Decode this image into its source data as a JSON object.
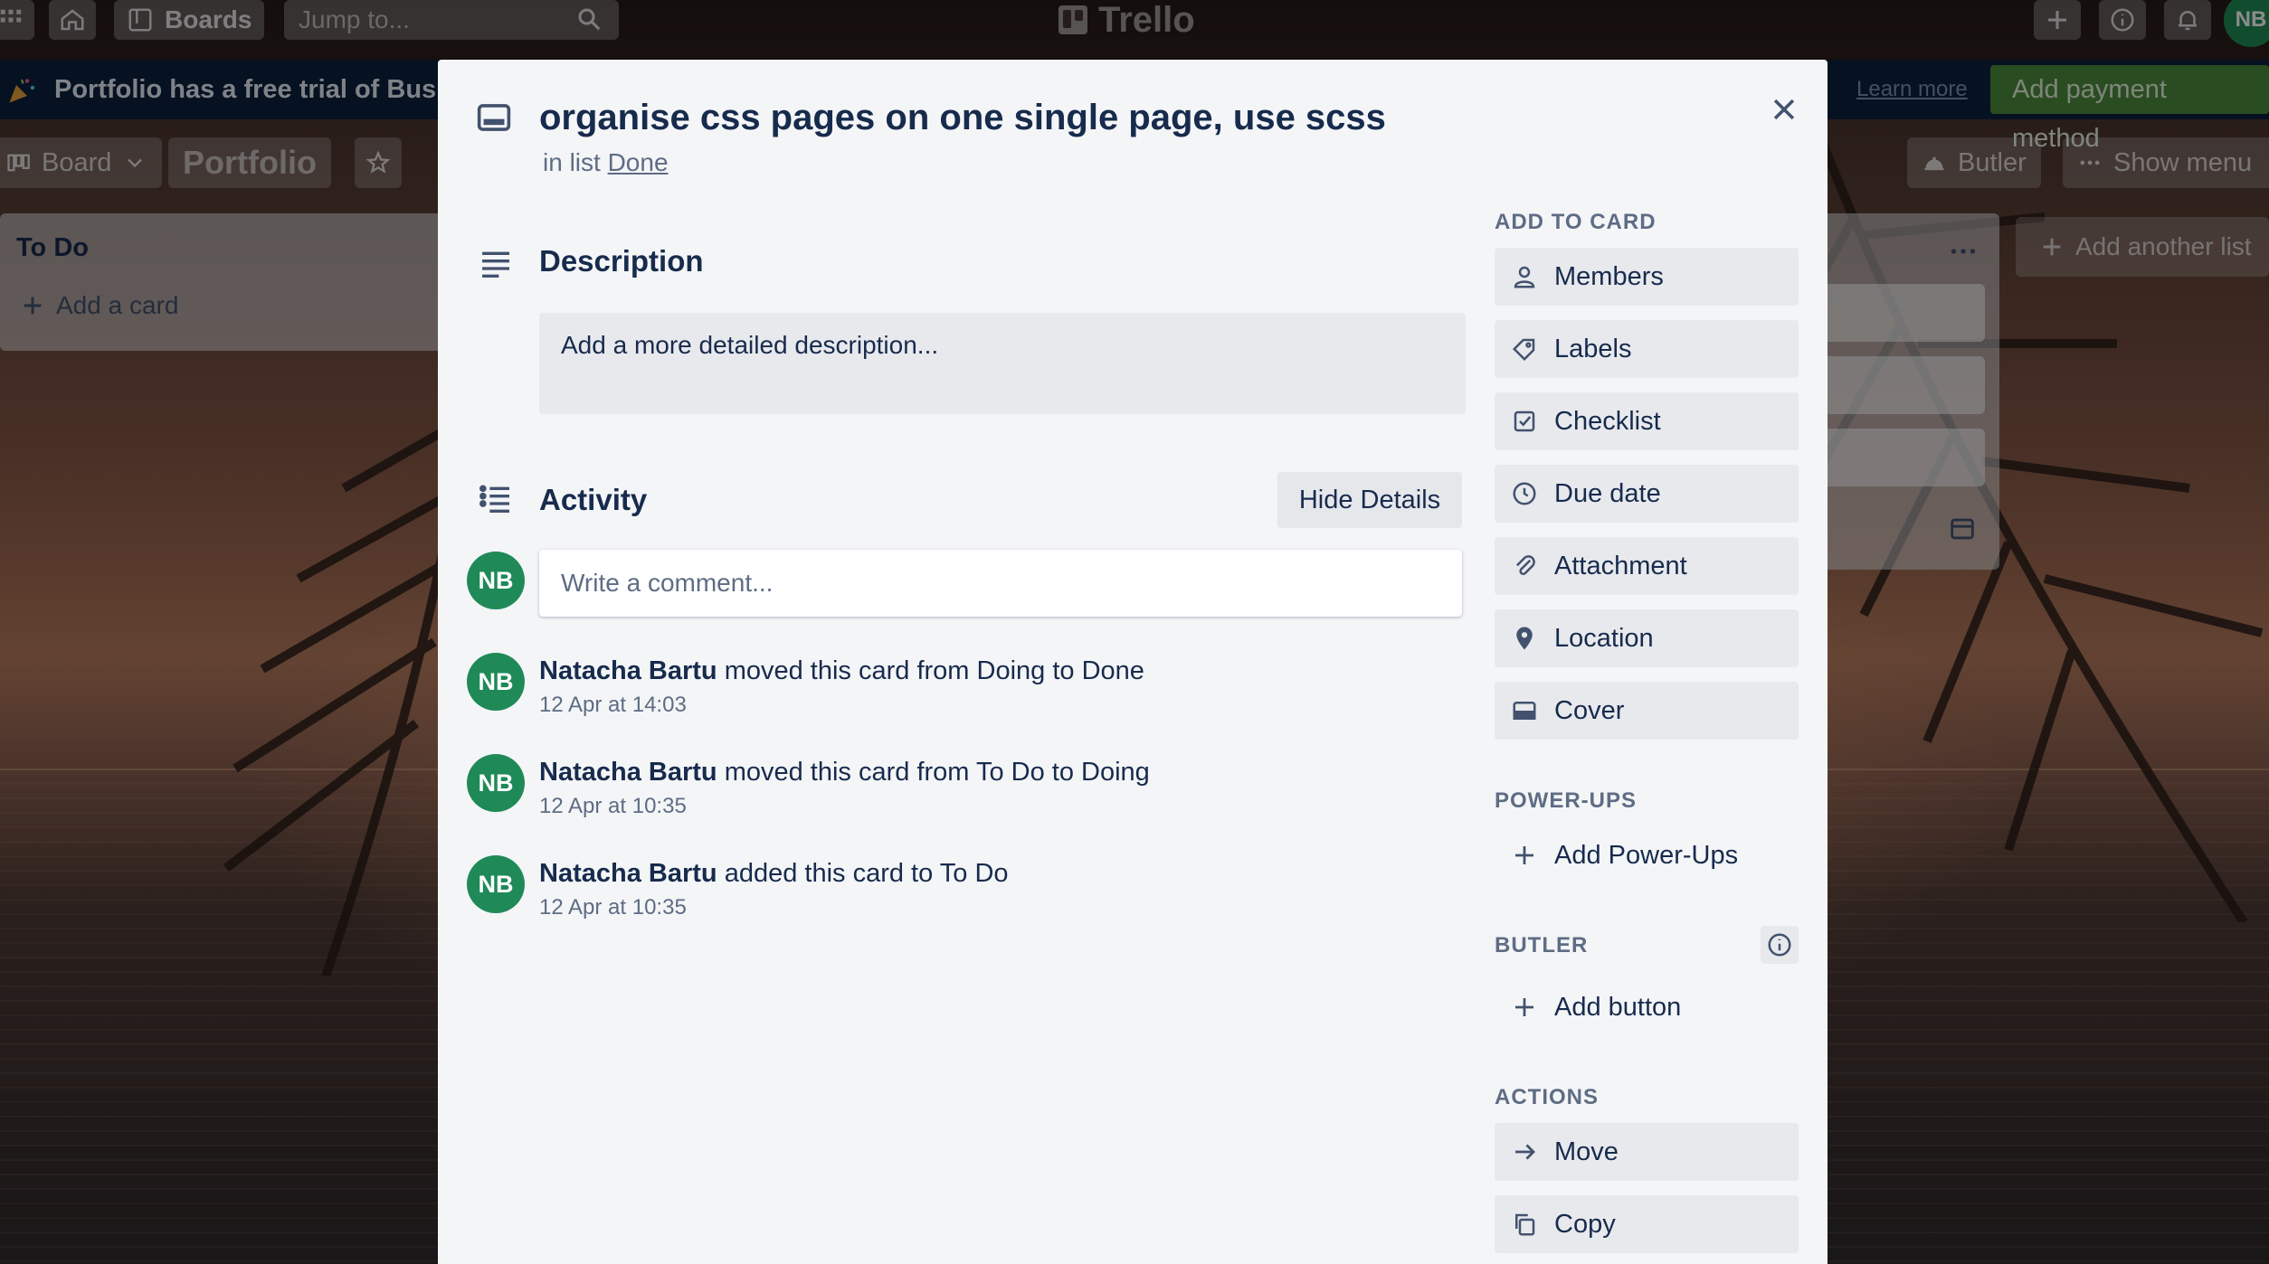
{
  "topbar": {
    "boards_label": "Boards",
    "search_placeholder": "Jump to...",
    "brand": "Trello",
    "user_initials": "NB"
  },
  "banner": {
    "text": "Portfolio has a free trial of Business Class",
    "learn_more": "Learn more",
    "payment_button": "Add payment method"
  },
  "board_header": {
    "view_label": "Board",
    "board_name": "Portfolio",
    "butler_label": "Butler",
    "show_menu_label": "Show menu"
  },
  "lists": {
    "todo_title": "To Do",
    "add_card_label": "Add a card",
    "add_list_label": "Add another list"
  },
  "card": {
    "title": "organise css pages on one single page, use scss",
    "in_list_prefix": "in list",
    "list_name": "Done",
    "close_icon": "close-icon"
  },
  "description": {
    "heading": "Description",
    "placeholder": "Add a more detailed description..."
  },
  "activity": {
    "heading": "Activity",
    "hide_details": "Hide Details",
    "comment_placeholder": "Write a comment...",
    "avatar_initials": "NB",
    "entries": [
      {
        "initials": "NB",
        "author": "Natacha Bartu",
        "action": "moved this card from Doing to Done",
        "time": "12 Apr at 14:03"
      },
      {
        "initials": "NB",
        "author": "Natacha Bartu",
        "action": "moved this card from To Do to Doing",
        "time": "12 Apr at 10:35"
      },
      {
        "initials": "NB",
        "author": "Natacha Bartu",
        "action": "added this card to To Do",
        "time": "12 Apr at 10:35"
      }
    ]
  },
  "sidebar": {
    "add_to_card_heading": "ADD TO CARD",
    "add_to_card": [
      {
        "label": "Members",
        "icon": "person-icon"
      },
      {
        "label": "Labels",
        "icon": "tag-icon"
      },
      {
        "label": "Checklist",
        "icon": "checkbox-icon"
      },
      {
        "label": "Due date",
        "icon": "clock-icon"
      },
      {
        "label": "Attachment",
        "icon": "paperclip-icon"
      },
      {
        "label": "Location",
        "icon": "map-pin-icon"
      },
      {
        "label": "Cover",
        "icon": "cover-icon"
      }
    ],
    "power_ups_heading": "POWER-UPS",
    "add_power_ups": "Add Power-Ups",
    "butler_heading": "BUTLER",
    "add_button": "Add button",
    "actions_heading": "ACTIONS",
    "actions": [
      {
        "label": "Move",
        "icon": "arrow-right-icon"
      },
      {
        "label": "Copy",
        "icon": "copy-icon"
      }
    ]
  },
  "colors": {
    "modal_bg": "#f4f5f7",
    "text_primary": "#172b4d",
    "text_secondary": "#5e6c84",
    "avatar_green": "#1f8a57",
    "banner_bg": "#0b1f3f",
    "payment_green": "#4d8a3c"
  }
}
